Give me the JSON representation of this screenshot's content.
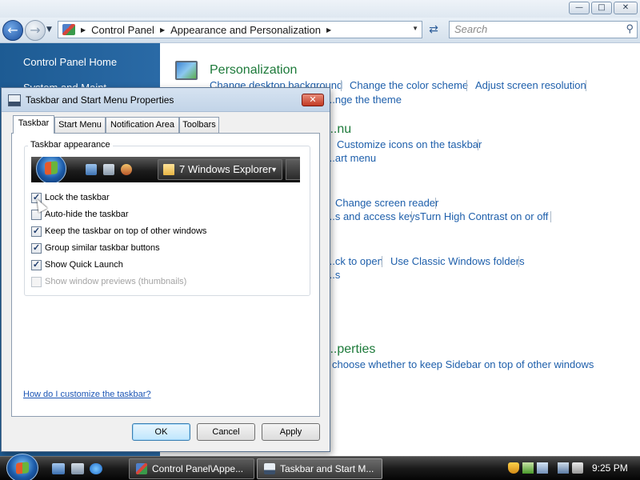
{
  "control_panel": {
    "breadcrumbs": [
      "Control Panel",
      "Appearance and Personalization"
    ],
    "search_placeholder": "Search",
    "sidebar": {
      "home": "Control Panel Home",
      "item2_partial": "System and Maint..."
    },
    "personalization": {
      "heading": "Personalization",
      "links": [
        "Change desktop background",
        "Change the color scheme",
        "Adjust screen resolution",
        "...nge the theme"
      ]
    },
    "partial_headings": [
      "...nu",
      "...perties"
    ],
    "partial_links": {
      "customize_icons": "Customize icons on the taskbar",
      "start_menu": "...art menu",
      "screen_reader": "Change screen reader",
      "access_keys": "...s and access keys",
      "high_contrast": "Turn High Contrast on or off",
      "click_open": "...ck to open",
      "classic_folders": "Use Classic Windows folders",
      "s_partial": "...s",
      "sidebar_top": "choose whether to keep Sidebar on top of other windows"
    }
  },
  "dialog": {
    "title": "Taskbar and Start Menu Properties",
    "tabs": [
      "Taskbar",
      "Start Menu",
      "Notification Area",
      "Toolbars"
    ],
    "active_tab": "Taskbar",
    "group_label": "Taskbar appearance",
    "preview_item": "7 Windows Explorer",
    "options": [
      {
        "label": "Lock the taskbar",
        "checked": true,
        "enabled": true
      },
      {
        "label": "Auto-hide the taskbar",
        "checked": false,
        "enabled": true
      },
      {
        "label": "Keep the taskbar on top of other windows",
        "checked": true,
        "enabled": true
      },
      {
        "label": "Group similar taskbar buttons",
        "checked": true,
        "enabled": true
      },
      {
        "label": "Show Quick Launch",
        "checked": true,
        "enabled": true
      },
      {
        "label": "Show window previews (thumbnails)",
        "checked": false,
        "enabled": false
      }
    ],
    "help_link": "How do I customize the taskbar?",
    "buttons": {
      "ok": "OK",
      "cancel": "Cancel",
      "apply": "Apply"
    }
  },
  "taskbar": {
    "tasks": [
      "Control Panel\\Appe...",
      "Taskbar and Start M..."
    ],
    "clock": "9:25 PM"
  },
  "icons": {
    "back": "back-arrow-icon",
    "forward": "forward-arrow-icon",
    "refresh": "refresh-icon",
    "search": "search-icon",
    "close": "close-icon",
    "start": "windows-start-orb-icon"
  },
  "colors": {
    "sidebar": "#2a6aa6",
    "link": "#1e5fab",
    "heading": "#1d7a3a",
    "close_button": "#c23a23"
  }
}
